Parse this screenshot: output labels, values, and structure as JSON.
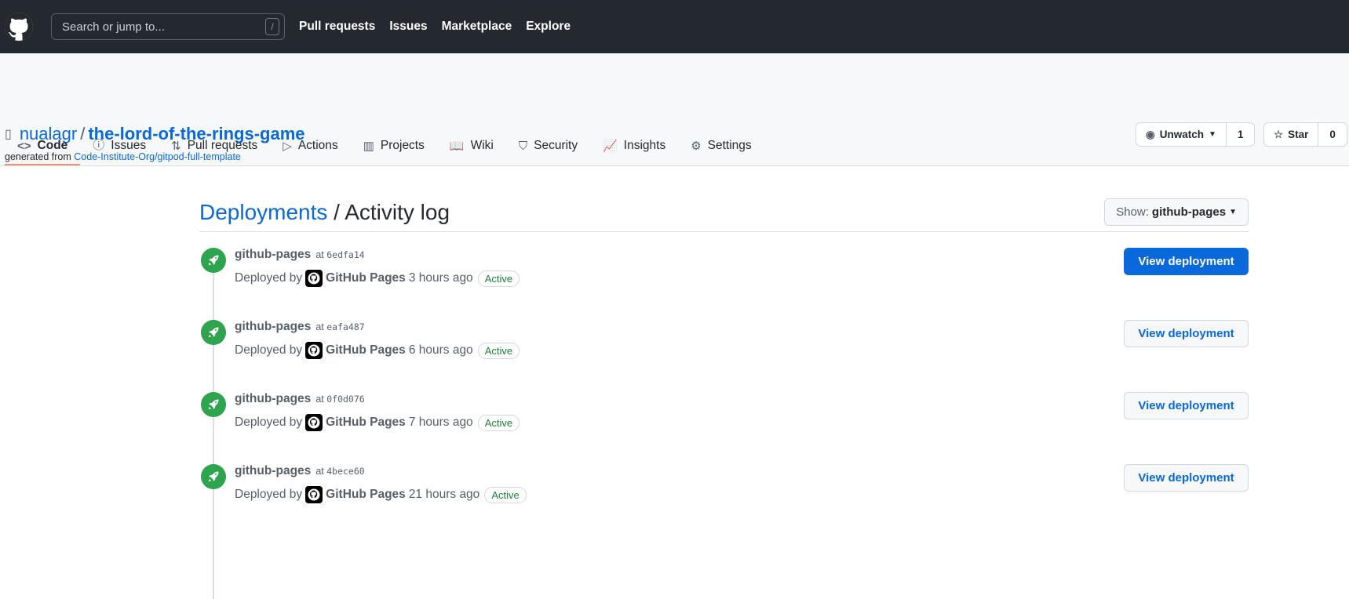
{
  "header": {
    "search_placeholder": "Search or jump to...",
    "slash": "/",
    "nav": [
      "Pull requests",
      "Issues",
      "Marketplace",
      "Explore"
    ]
  },
  "repo": {
    "owner": "nualagr",
    "sep": "/",
    "name": "the-lord-of-the-rings-game",
    "generated_prefix": "generated from",
    "template": "Code-Institute-Org/gitpod-full-template",
    "watch_label": "Unwatch",
    "watch_count": "1",
    "star_label": "Star",
    "star_count": "0"
  },
  "tabs": [
    {
      "label": "Code",
      "icon": "<>"
    },
    {
      "label": "Issues",
      "icon": "ⓘ"
    },
    {
      "label": "Pull requests",
      "icon": "⇅"
    },
    {
      "label": "Actions",
      "icon": "▷"
    },
    {
      "label": "Projects",
      "icon": "▥"
    },
    {
      "label": "Wiki",
      "icon": "📖"
    },
    {
      "label": "Security",
      "icon": "⛉"
    },
    {
      "label": "Insights",
      "icon": "📈"
    },
    {
      "label": "Settings",
      "icon": "⚙"
    }
  ],
  "page": {
    "crumb": "Deployments",
    "sep": " / ",
    "title": "Activity log",
    "show_label": "Show:",
    "show_value": "github-pages"
  },
  "deployments": [
    {
      "env": "github-pages",
      "at": "at",
      "sha": "6edfa14",
      "by": "Deployed by",
      "deployer": "GitHub Pages",
      "time": "3 hours ago",
      "status": "Active",
      "button": "View deployment"
    },
    {
      "env": "github-pages",
      "at": "at",
      "sha": "eafa487",
      "by": "Deployed by",
      "deployer": "GitHub Pages",
      "time": "6 hours ago",
      "status": "Active",
      "button": "View deployment"
    },
    {
      "env": "github-pages",
      "at": "at",
      "sha": "0f0d076",
      "by": "Deployed by",
      "deployer": "GitHub Pages",
      "time": "7 hours ago",
      "status": "Active",
      "button": "View deployment"
    },
    {
      "env": "github-pages",
      "at": "at",
      "sha": "4bece60",
      "by": "Deployed by",
      "deployer": "GitHub Pages",
      "time": "21 hours ago",
      "status": "Active",
      "button": "View deployment"
    }
  ]
}
